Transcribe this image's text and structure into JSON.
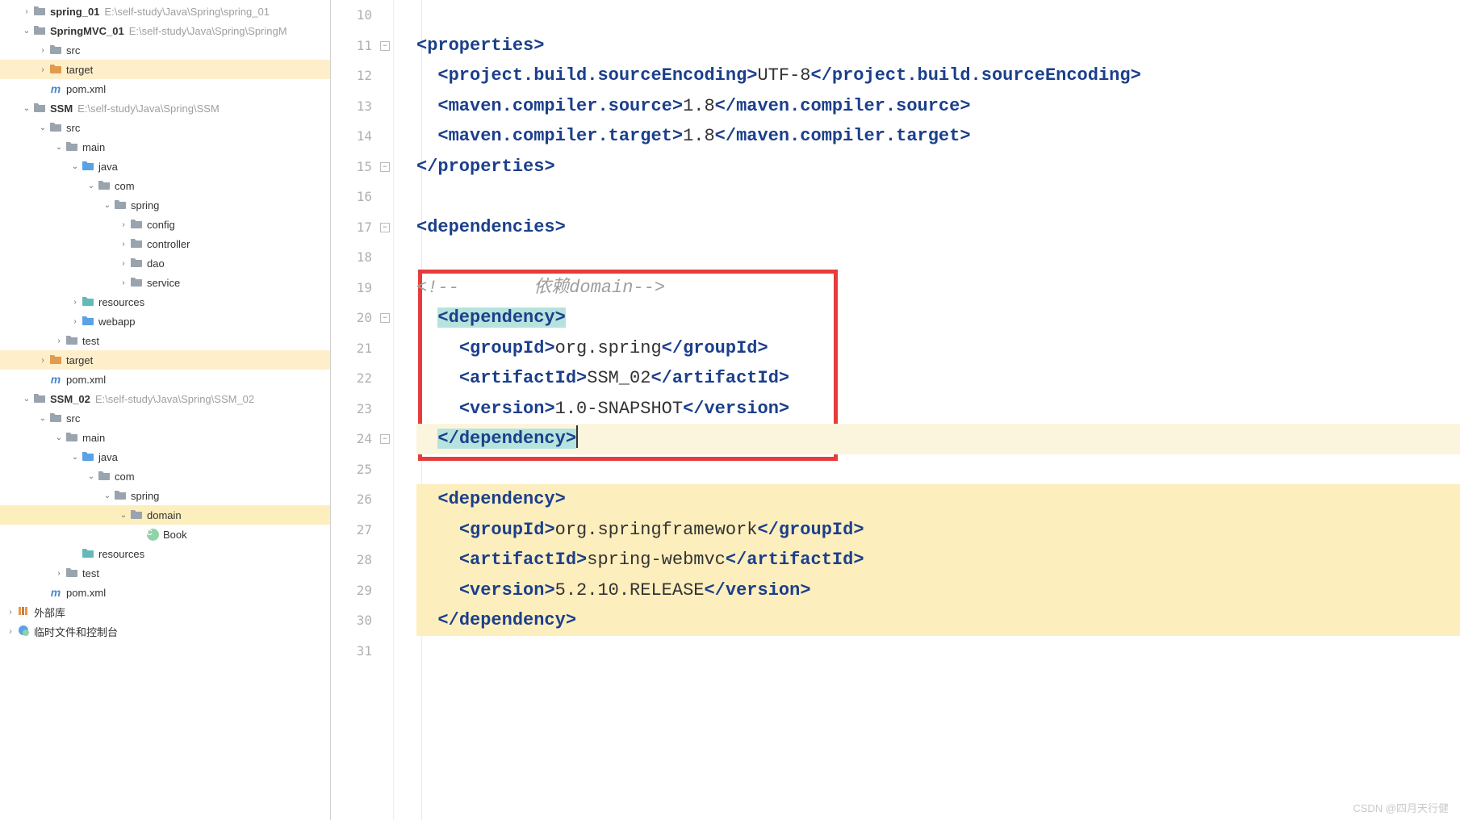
{
  "sidebar": {
    "items": [
      {
        "indent": 1,
        "caret": ">",
        "icon": "folder-gray",
        "label": "spring_01",
        "bold": true,
        "path": "E:\\self-study\\Java\\Spring\\spring_01"
      },
      {
        "indent": 1,
        "caret": "v",
        "icon": "folder-gray",
        "label": "SpringMVC_01",
        "bold": true,
        "path": "E:\\self-study\\Java\\Spring\\SpringM"
      },
      {
        "indent": 2,
        "caret": ">",
        "icon": "folder-gray",
        "label": "src"
      },
      {
        "indent": 2,
        "caret": ">",
        "icon": "folder-orange",
        "label": "target",
        "highlight": true
      },
      {
        "indent": 2,
        "caret": "",
        "icon": "maven",
        "label": "pom.xml"
      },
      {
        "indent": 1,
        "caret": "v",
        "icon": "folder-gray",
        "label": "SSM",
        "bold": true,
        "path": "E:\\self-study\\Java\\Spring\\SSM"
      },
      {
        "indent": 2,
        "caret": "v",
        "icon": "folder-gray",
        "label": "src"
      },
      {
        "indent": 3,
        "caret": "v",
        "icon": "folder-gray",
        "label": "main"
      },
      {
        "indent": 4,
        "caret": "v",
        "icon": "folder-blue",
        "label": "java"
      },
      {
        "indent": 5,
        "caret": "v",
        "icon": "folder-gray",
        "label": "com"
      },
      {
        "indent": 6,
        "caret": "v",
        "icon": "folder-gray",
        "label": "spring"
      },
      {
        "indent": 7,
        "caret": ">",
        "icon": "folder-gray",
        "label": "config"
      },
      {
        "indent": 7,
        "caret": ">",
        "icon": "folder-gray",
        "label": "controller"
      },
      {
        "indent": 7,
        "caret": ">",
        "icon": "folder-gray",
        "label": "dao"
      },
      {
        "indent": 7,
        "caret": ">",
        "icon": "folder-gray",
        "label": "service"
      },
      {
        "indent": 4,
        "caret": ">",
        "icon": "folder-teal",
        "label": "resources"
      },
      {
        "indent": 4,
        "caret": ">",
        "icon": "folder-blue",
        "label": "webapp"
      },
      {
        "indent": 3,
        "caret": ">",
        "icon": "folder-gray",
        "label": "test"
      },
      {
        "indent": 2,
        "caret": ">",
        "icon": "folder-orange",
        "label": "target",
        "highlight": true
      },
      {
        "indent": 2,
        "caret": "",
        "icon": "maven",
        "label": "pom.xml"
      },
      {
        "indent": 1,
        "caret": "v",
        "icon": "folder-gray",
        "label": "SSM_02",
        "bold": true,
        "path": "E:\\self-study\\Java\\Spring\\SSM_02"
      },
      {
        "indent": 2,
        "caret": "v",
        "icon": "folder-gray",
        "label": "src"
      },
      {
        "indent": 3,
        "caret": "v",
        "icon": "folder-gray",
        "label": "main"
      },
      {
        "indent": 4,
        "caret": "v",
        "icon": "folder-blue",
        "label": "java"
      },
      {
        "indent": 5,
        "caret": "v",
        "icon": "folder-gray",
        "label": "com"
      },
      {
        "indent": 6,
        "caret": "v",
        "icon": "folder-gray",
        "label": "spring"
      },
      {
        "indent": 7,
        "caret": "v",
        "icon": "folder-gray",
        "label": "domain",
        "selected": true
      },
      {
        "indent": 8,
        "caret": "",
        "icon": "class",
        "label": "Book"
      },
      {
        "indent": 4,
        "caret": "",
        "icon": "folder-teal",
        "label": "resources"
      },
      {
        "indent": 3,
        "caret": ">",
        "icon": "folder-gray",
        "label": "test"
      },
      {
        "indent": 2,
        "caret": "",
        "icon": "maven",
        "label": "pom.xml"
      },
      {
        "indent": 0,
        "caret": ">",
        "icon": "lib",
        "label": "外部库"
      },
      {
        "indent": 0,
        "caret": ">",
        "icon": "scratch",
        "label": "临时文件和控制台"
      }
    ]
  },
  "editor": {
    "startLine": 10,
    "lines": [
      {
        "n": 10,
        "segs": []
      },
      {
        "n": 11,
        "segs": [
          {
            "t": "brk",
            "v": "<"
          },
          {
            "t": "tag",
            "v": "properties"
          },
          {
            "t": "brk",
            "v": ">"
          }
        ]
      },
      {
        "n": 12,
        "segs": [
          {
            "t": "sp",
            "v": "  "
          },
          {
            "t": "brk",
            "v": "<"
          },
          {
            "t": "tag",
            "v": "project.build.sourceEncoding"
          },
          {
            "t": "brk",
            "v": ">"
          },
          {
            "t": "text",
            "v": "UTF-8"
          },
          {
            "t": "brk",
            "v": "</"
          },
          {
            "t": "tag",
            "v": "project.build.sourceEncoding"
          },
          {
            "t": "brk",
            "v": ">"
          }
        ]
      },
      {
        "n": 13,
        "segs": [
          {
            "t": "sp",
            "v": "  "
          },
          {
            "t": "brk",
            "v": "<"
          },
          {
            "t": "tag",
            "v": "maven.compiler.source"
          },
          {
            "t": "brk",
            "v": ">"
          },
          {
            "t": "text",
            "v": "1.8"
          },
          {
            "t": "brk",
            "v": "</"
          },
          {
            "t": "tag",
            "v": "maven.compiler.source"
          },
          {
            "t": "brk",
            "v": ">"
          }
        ]
      },
      {
        "n": 14,
        "segs": [
          {
            "t": "sp",
            "v": "  "
          },
          {
            "t": "brk",
            "v": "<"
          },
          {
            "t": "tag",
            "v": "maven.compiler.target"
          },
          {
            "t": "brk",
            "v": ">"
          },
          {
            "t": "text",
            "v": "1.8"
          },
          {
            "t": "brk",
            "v": "</"
          },
          {
            "t": "tag",
            "v": "maven.compiler.target"
          },
          {
            "t": "brk",
            "v": ">"
          }
        ]
      },
      {
        "n": 15,
        "segs": [
          {
            "t": "brk",
            "v": "</"
          },
          {
            "t": "tag",
            "v": "properties"
          },
          {
            "t": "brk",
            "v": ">"
          }
        ]
      },
      {
        "n": 16,
        "segs": []
      },
      {
        "n": 17,
        "segs": [
          {
            "t": "brk",
            "v": "<"
          },
          {
            "t": "tag",
            "v": "dependencies"
          },
          {
            "t": "brk",
            "v": ">"
          }
        ]
      },
      {
        "n": 18,
        "segs": []
      },
      {
        "n": 19,
        "segs": [
          {
            "t": "comment",
            "v": "<!--       依赖domain-->"
          }
        ],
        "comment": true
      },
      {
        "n": 20,
        "segs": [
          {
            "t": "sp",
            "v": "  "
          },
          {
            "t": "brk",
            "v": "<",
            "teal": true
          },
          {
            "t": "tag",
            "v": "dependency",
            "teal": true
          },
          {
            "t": "brk",
            "v": ">",
            "teal": true
          }
        ]
      },
      {
        "n": 21,
        "segs": [
          {
            "t": "sp",
            "v": "    "
          },
          {
            "t": "brk",
            "v": "<"
          },
          {
            "t": "tag",
            "v": "groupId"
          },
          {
            "t": "brk",
            "v": ">"
          },
          {
            "t": "text",
            "v": "org.spring"
          },
          {
            "t": "brk",
            "v": "</"
          },
          {
            "t": "tag",
            "v": "groupId"
          },
          {
            "t": "brk",
            "v": ">"
          }
        ]
      },
      {
        "n": 22,
        "segs": [
          {
            "t": "sp",
            "v": "    "
          },
          {
            "t": "brk",
            "v": "<"
          },
          {
            "t": "tag",
            "v": "artifactId"
          },
          {
            "t": "brk",
            "v": ">"
          },
          {
            "t": "text",
            "v": "SSM_02"
          },
          {
            "t": "brk",
            "v": "</"
          },
          {
            "t": "tag",
            "v": "artifactId"
          },
          {
            "t": "brk",
            "v": ">"
          }
        ]
      },
      {
        "n": 23,
        "segs": [
          {
            "t": "sp",
            "v": "    "
          },
          {
            "t": "brk",
            "v": "<"
          },
          {
            "t": "tag",
            "v": "version"
          },
          {
            "t": "brk",
            "v": ">"
          },
          {
            "t": "text",
            "v": "1.0-SNAPSHOT"
          },
          {
            "t": "brk",
            "v": "</"
          },
          {
            "t": "tag",
            "v": "version"
          },
          {
            "t": "brk",
            "v": ">"
          }
        ]
      },
      {
        "n": 24,
        "cursor": true,
        "segs": [
          {
            "t": "sp",
            "v": "  "
          },
          {
            "t": "brk",
            "v": "</",
            "teal": true
          },
          {
            "t": "tag",
            "v": "dependency",
            "teal": true
          },
          {
            "t": "brk",
            "v": ">",
            "teal": true
          }
        ]
      },
      {
        "n": 25,
        "segs": []
      },
      {
        "n": 26,
        "diff": true,
        "segs": [
          {
            "t": "sp",
            "v": "  "
          },
          {
            "t": "brk",
            "v": "<"
          },
          {
            "t": "tag",
            "v": "dependency"
          },
          {
            "t": "brk",
            "v": ">"
          }
        ]
      },
      {
        "n": 27,
        "diff": true,
        "segs": [
          {
            "t": "sp",
            "v": "    "
          },
          {
            "t": "brk",
            "v": "<"
          },
          {
            "t": "tag",
            "v": "groupId"
          },
          {
            "t": "brk",
            "v": ">"
          },
          {
            "t": "text",
            "v": "org.springframework"
          },
          {
            "t": "brk",
            "v": "</"
          },
          {
            "t": "tag",
            "v": "groupId"
          },
          {
            "t": "brk",
            "v": ">"
          }
        ]
      },
      {
        "n": 28,
        "diff": true,
        "segs": [
          {
            "t": "sp",
            "v": "    "
          },
          {
            "t": "brk",
            "v": "<"
          },
          {
            "t": "tag",
            "v": "artifactId"
          },
          {
            "t": "brk",
            "v": ">"
          },
          {
            "t": "text",
            "v": "spring-webmvc"
          },
          {
            "t": "brk",
            "v": "</"
          },
          {
            "t": "tag",
            "v": "artifactId"
          },
          {
            "t": "brk",
            "v": ">"
          }
        ]
      },
      {
        "n": 29,
        "diff": true,
        "segs": [
          {
            "t": "sp",
            "v": "    "
          },
          {
            "t": "brk",
            "v": "<"
          },
          {
            "t": "tag",
            "v": "version"
          },
          {
            "t": "brk",
            "v": ">"
          },
          {
            "t": "text",
            "v": "5.2.10.RELEASE"
          },
          {
            "t": "brk",
            "v": "</"
          },
          {
            "t": "tag",
            "v": "version"
          },
          {
            "t": "brk",
            "v": ">"
          }
        ]
      },
      {
        "n": 30,
        "diff": true,
        "segs": [
          {
            "t": "sp",
            "v": "  "
          },
          {
            "t": "brk",
            "v": "</"
          },
          {
            "t": "tag",
            "v": "dependency"
          },
          {
            "t": "brk",
            "v": ">"
          }
        ]
      },
      {
        "n": 31,
        "segs": []
      }
    ],
    "redBox": {
      "topLine": 19,
      "bottomLine": 24
    }
  },
  "watermark": "CSDN @四月天行健"
}
